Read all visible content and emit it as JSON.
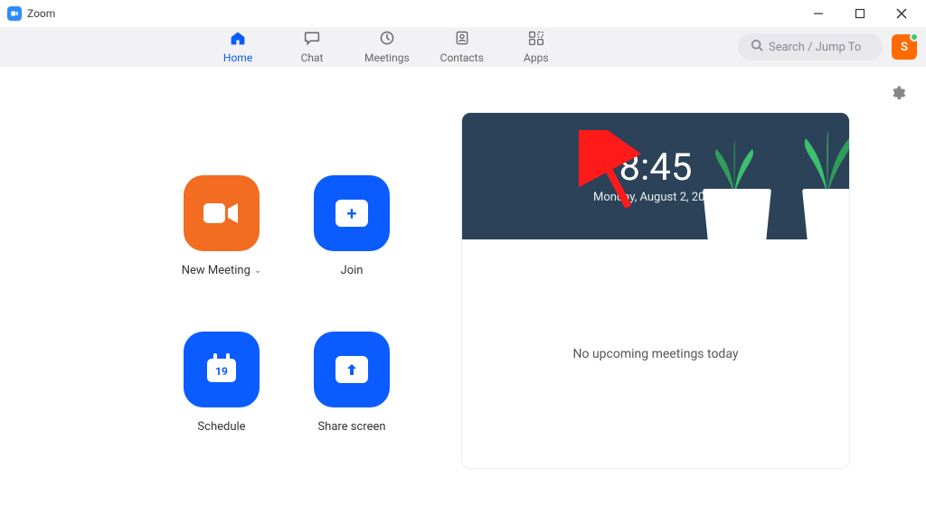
{
  "app": {
    "title": "Zoom",
    "avatar_initial": "S"
  },
  "nav": {
    "home": "Home",
    "chat": "Chat",
    "meetings": "Meetings",
    "contacts": "Contacts",
    "apps": "Apps"
  },
  "search": {
    "placeholder": "Search / Jump To"
  },
  "actions": {
    "new_meeting": "New Meeting",
    "join": "Join",
    "schedule": "Schedule",
    "share_screen": "Share screen",
    "calendar_day": "19"
  },
  "card": {
    "time": "8:45",
    "date": "Monday, August 2, 2021",
    "empty_text": "No upcoming meetings today"
  },
  "colors": {
    "accent": "#0b5cff",
    "orange": "#f26d21",
    "toolbar": "#f2f1f4",
    "hero": "#2b4258"
  }
}
